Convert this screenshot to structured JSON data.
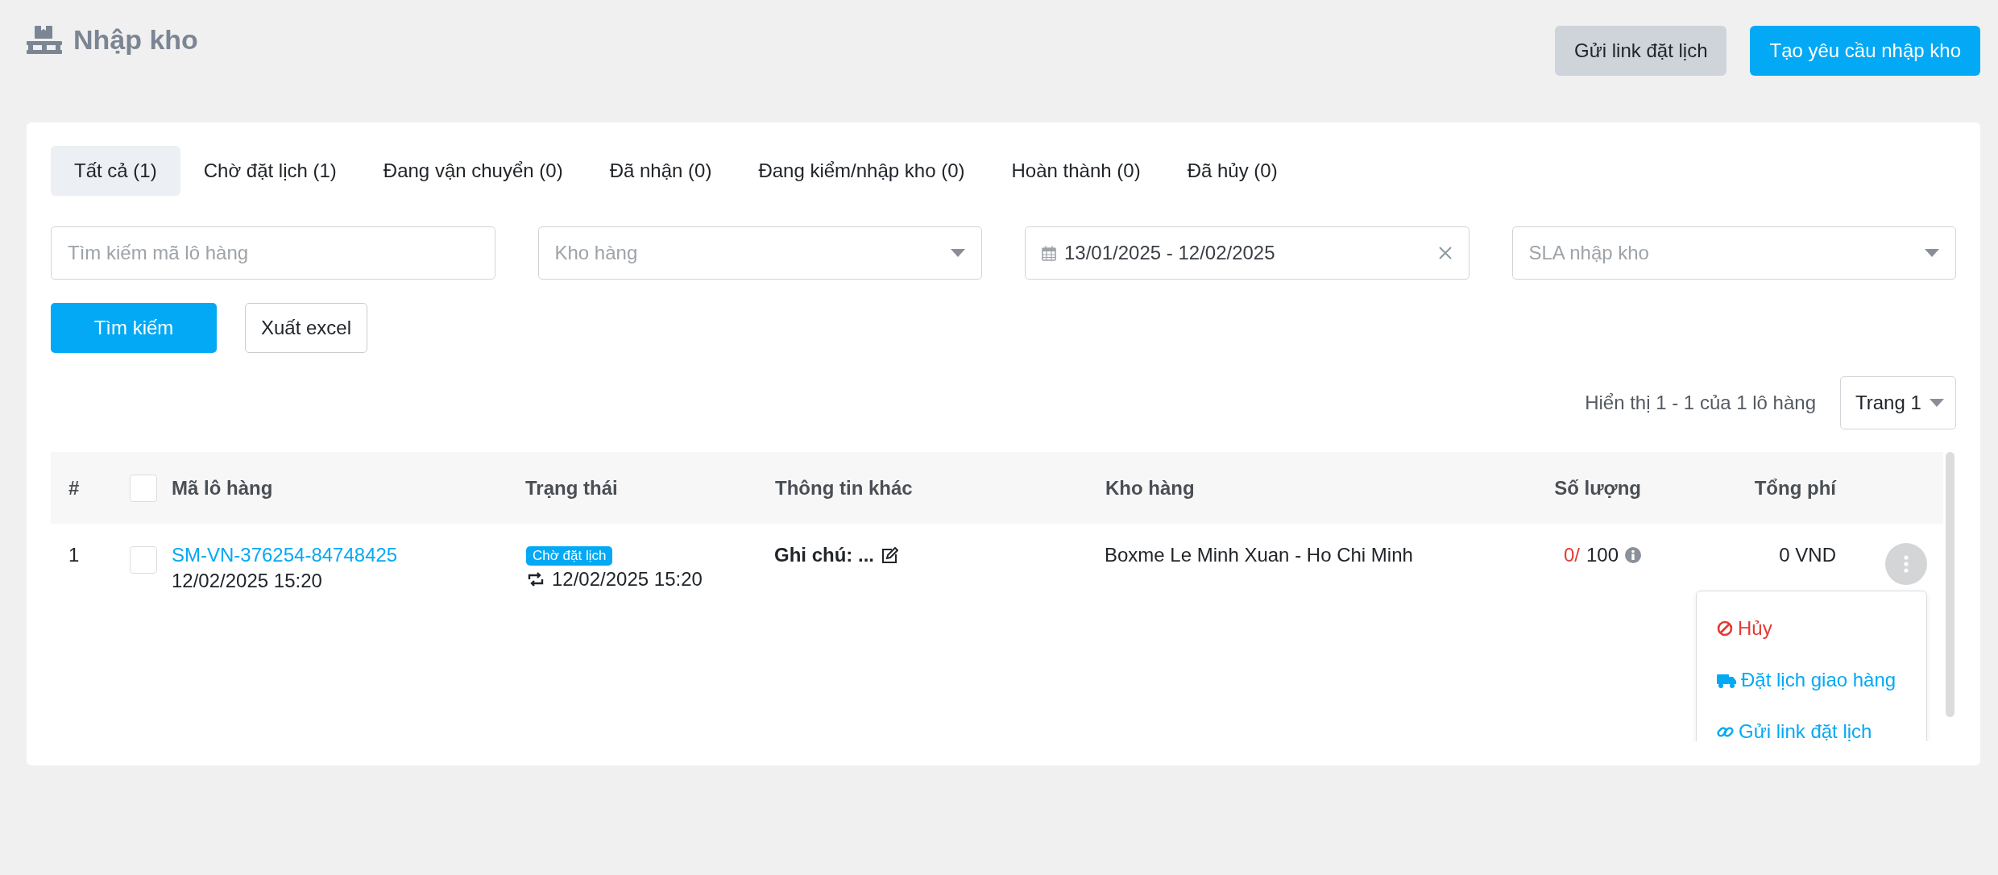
{
  "page": {
    "title": "Nhập kho"
  },
  "header_buttons": [
    {
      "label": "Gửi link đặt lịch",
      "kind": "secondary"
    },
    {
      "label": "Tạo yêu cầu nhập kho",
      "kind": "primary"
    }
  ],
  "tabs": [
    {
      "label": "Tất cả (1)",
      "selected": true
    },
    {
      "label": "Chờ đặt lịch (1)",
      "selected": false
    },
    {
      "label": "Đang vận chuyển (0)",
      "selected": false
    },
    {
      "label": "Đã nhận (0)",
      "selected": false
    },
    {
      "label": "Đang kiểm/nhập kho (0)",
      "selected": false
    },
    {
      "label": "Hoàn thành (0)",
      "selected": false
    },
    {
      "label": "Đã hủy (0)",
      "selected": false
    }
  ],
  "filters": [
    {
      "kind": "text",
      "placeholder": "Tìm kiếm mã lô hàng"
    },
    {
      "kind": "select",
      "placeholder": "Kho hàng"
    },
    {
      "kind": "daterange",
      "value": "13/01/2025 - 12/02/2025"
    },
    {
      "kind": "select",
      "placeholder": "SLA nhập kho"
    }
  ],
  "actions": [
    {
      "label": "Tìm kiếm",
      "kind": "primary"
    },
    {
      "label": "Xuất excel",
      "kind": "outline"
    }
  ],
  "pagination": {
    "summary": "Hiển thị 1 - 1 của 1 lô hàng",
    "page": "Trang 1"
  },
  "table": {
    "columns": [
      "#",
      "Mã lô hàng",
      "Trạng thái",
      "Thông tin khác",
      "Kho hàng",
      "Số lượng",
      "Tổng phí"
    ],
    "select_all_checked": false,
    "rows": [
      {
        "index": "1",
        "checked": false,
        "code": "SM-VN-376254-84748425",
        "created": "12/02/2025 15:20",
        "status": "Chờ đặt lịch",
        "status_time": "12/02/2025 15:20",
        "note": "Ghi chú: ...",
        "warehouse": "Boxme Le Minh Xuan - Ho Chi Minh",
        "received": "0/",
        "quantity": "100",
        "total_fee": "0 VND",
        "menu_open": true
      }
    ]
  },
  "row_menu": [
    {
      "label": "Hủy",
      "kind": "danger"
    },
    {
      "label": "Đặt lịch giao hàng",
      "kind": "schedule"
    },
    {
      "label": "Gửi link đặt lịch",
      "kind": "link"
    }
  ]
}
